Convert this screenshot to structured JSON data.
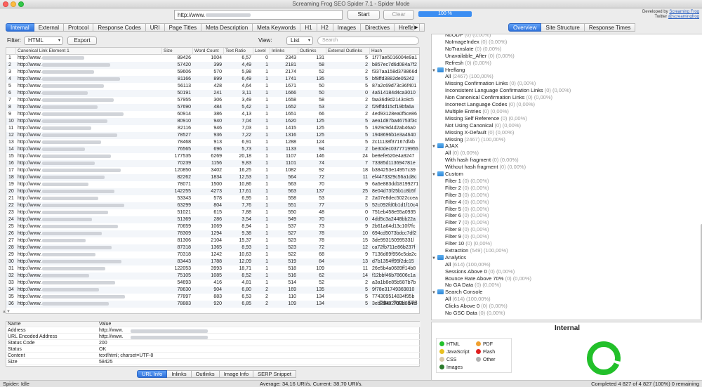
{
  "window": {
    "title": "Screaming Frog SEO Spider 7.1 - Spider Mode"
  },
  "toolbar": {
    "url_value": "http://www.",
    "start_label": "Start",
    "clear_label": "Clear",
    "progress": "100 %",
    "dev_line1": "Developed by",
    "dev_link": "Screaming Frog",
    "dev_line2": "Twitter",
    "dev_twitter": "@screamingfrog"
  },
  "tabs": [
    "Internal",
    "External",
    "Protocol",
    "Response Codes",
    "URI",
    "Page Titles",
    "Meta Description",
    "Meta Keywords",
    "H1",
    "H2",
    "Images",
    "Directives",
    "Hreflang"
  ],
  "filter": {
    "label": "Filter:",
    "value": "HTML",
    "export_label": "Export",
    "view_label": "View:",
    "view_value": "List",
    "search_placeholder": "Search"
  },
  "grid": {
    "columns": [
      "",
      "Canonical Link Element 1",
      "Size",
      "Word Count",
      "Text Ratio",
      "Level",
      "Inlinks",
      "Outlinks",
      "External Outlinks",
      "Hash"
    ],
    "rows": [
      [
        "1",
        "http://www.",
        "89426",
        "1004",
        "6,57",
        "0",
        "2343",
        "131",
        "5",
        "1f77ae5016004e9a1"
      ],
      [
        "2",
        "http://www.",
        "57420",
        "399",
        "4,49",
        "1",
        "2181",
        "58",
        "2",
        "b857ec7d6d084a7f2"
      ],
      [
        "3",
        "http://www.",
        "59606",
        "570",
        "5,98",
        "1",
        "2174",
        "52",
        "2",
        "f337aa158d378866d"
      ],
      [
        "4",
        "http://www.",
        "81166",
        "899",
        "6,49",
        "1",
        "1741",
        "135",
        "5",
        "bf8ffd3882de05242"
      ],
      [
        "5",
        "http://www.",
        "56113",
        "428",
        "4,64",
        "1",
        "1671",
        "50",
        "5",
        "87a2c69d73c36f401"
      ],
      [
        "6",
        "http://www.",
        "50191",
        "241",
        "3,11",
        "1",
        "1666",
        "50",
        "0",
        "4a514184d4ca3010"
      ],
      [
        "7",
        "http://www.",
        "57955",
        "306",
        "3,49",
        "1",
        "1658",
        "58",
        "2",
        "faa36d9d2143c8c5"
      ],
      [
        "8",
        "http://www.",
        "57690",
        "484",
        "5,42",
        "1",
        "1652",
        "53",
        "2",
        "f29ffdd15cf19bfa6a"
      ],
      [
        "9",
        "http://www.",
        "60914",
        "386",
        "4,13",
        "1",
        "1651",
        "66",
        "2",
        "4ed93128ea0f5ce86"
      ],
      [
        "10",
        "http://www.",
        "80910",
        "940",
        "7,04",
        "1",
        "1620",
        "125",
        "5",
        "aea1d87ba46753f3c"
      ],
      [
        "11",
        "http://www.",
        "82116",
        "946",
        "7,03",
        "1",
        "1415",
        "125",
        "5",
        "1929c9d4d2ab46a0"
      ],
      [
        "12",
        "http://www.",
        "78527",
        "936",
        "7,22",
        "1",
        "1316",
        "125",
        "5",
        "1948696b1e3a4640"
      ],
      [
        "13",
        "http://www.",
        "78468",
        "913",
        "6,91",
        "1",
        "1288",
        "124",
        "5",
        "2c11138f37167df4b"
      ],
      [
        "14",
        "http://www.",
        "76565",
        "696",
        "5,73",
        "1",
        "1133",
        "94",
        "2",
        "be30dec0377719955"
      ],
      [
        "15",
        "http://www.",
        "177535",
        "6269",
        "20,18",
        "1",
        "1107",
        "146",
        "24",
        "be8efe620e4a9247"
      ],
      [
        "16",
        "http://www.",
        "70239",
        "1156",
        "9,83",
        "1",
        "1101",
        "74",
        "7",
        "73385d113694781e"
      ],
      [
        "17",
        "http://www.",
        "120850",
        "3402",
        "16,25",
        "1",
        "1082",
        "92",
        "18",
        "b384253e14957c39"
      ],
      [
        "18",
        "http://www.",
        "82262",
        "1834",
        "12,53",
        "1",
        "564",
        "72",
        "11",
        "ef4473329c56a1d8c"
      ],
      [
        "19",
        "http://www.",
        "78071",
        "1500",
        "10,86",
        "1",
        "563",
        "70",
        "9",
        "6a6e883dd18199271"
      ],
      [
        "20",
        "http://www.",
        "142255",
        "4273",
        "17,61",
        "1",
        "563",
        "137",
        "25",
        "8e04d73f25b1c8b5f"
      ],
      [
        "21",
        "http://www.",
        "53343",
        "578",
        "6,95",
        "1",
        "558",
        "53",
        "2",
        "2a07e8dec5022ccea"
      ],
      [
        "22",
        "http://www.",
        "63299",
        "804",
        "7,76",
        "1",
        "551",
        "77",
        "5",
        "52c092fd0b1d1f10c4"
      ],
      [
        "23",
        "http://www.",
        "51021",
        "615",
        "7,88",
        "1",
        "550",
        "48",
        "0",
        "751eb458e55a0935"
      ],
      [
        "24",
        "http://www.",
        "51369",
        "286",
        "3,54",
        "1",
        "549",
        "70",
        "0",
        "4dd5c3a2448bb22a"
      ],
      [
        "25",
        "http://www.",
        "70659",
        "1069",
        "8,94",
        "1",
        "537",
        "73",
        "9",
        "2b61a64d13c10f7fc"
      ],
      [
        "26",
        "http://www.",
        "78309",
        "1294",
        "9,38",
        "1",
        "527",
        "78",
        "10",
        "694cd5073bdcc7df2"
      ],
      [
        "27",
        "http://www.",
        "81306",
        "2104",
        "15,37",
        "1",
        "523",
        "78",
        "15",
        "3de993150995331l"
      ],
      [
        "28",
        "http://www.",
        "87318",
        "1365",
        "8,93",
        "1",
        "523",
        "72",
        "12",
        "ca72fb711e86b237f"
      ],
      [
        "29",
        "http://www.",
        "70318",
        "1242",
        "10,63",
        "1",
        "522",
        "68",
        "9",
        "7136d89f956c5da2c"
      ],
      [
        "30",
        "http://www.",
        "83443",
        "1788",
        "12,09",
        "1",
        "519",
        "84",
        "13",
        "d7b1354ff95f2dc15"
      ],
      [
        "31",
        "http://www.",
        "122053",
        "3993",
        "18,71",
        "1",
        "518",
        "109",
        "11",
        "26e5b4a0689ff14b8"
      ],
      [
        "32",
        "http://www.",
        "75105",
        "1085",
        "8,52",
        "1",
        "516",
        "62",
        "14",
        "f12bbf46b78606c1a"
      ],
      [
        "33",
        "http://www.",
        "54693",
        "416",
        "4,81",
        "1",
        "514",
        "52",
        "2",
        "a3a1b8e85b587b7b"
      ],
      [
        "34",
        "http://www.",
        "78630",
        "904",
        "6,80",
        "2",
        "169",
        "135",
        "5",
        "9f78e31749369810"
      ],
      [
        "35",
        "http://www.",
        "77897",
        "883",
        "6,53",
        "2",
        "110",
        "134",
        "5",
        "774309514834f95b"
      ],
      [
        "36",
        "http://www.",
        "78883",
        "920",
        "6,85",
        "2",
        "109",
        "134",
        "5",
        "3eb29432707b884c"
      ]
    ],
    "filter_total_label": "Filter Total:",
    "filter_total_value": "578"
  },
  "details": {
    "header_name": "Name",
    "header_value": "Value",
    "rows": [
      [
        "Address",
        "http://www."
      ],
      [
        "URL Encoded Address",
        "http://www."
      ],
      [
        "Status Code",
        "200"
      ],
      [
        "Status",
        "OK"
      ],
      [
        "Content",
        "text/html; charset=UTF-8"
      ],
      [
        "Size",
        "58425"
      ]
    ]
  },
  "bottom_tabs": [
    "URL Info",
    "Inlinks",
    "Outlinks",
    "Image Info",
    "SERP Snippet"
  ],
  "right_tabs": [
    "Overview",
    "Site Structure",
    "Response Times"
  ],
  "tree": [
    {
      "indent": 2,
      "label": "NoODP",
      "count": "(0) (0,00%)"
    },
    {
      "indent": 2,
      "label": "NoImageIndex",
      "count": "(0) (0,00%)"
    },
    {
      "indent": 2,
      "label": "NoTranslate",
      "count": "(0) (0,00%)"
    },
    {
      "indent": 2,
      "label": "Unavailable_After",
      "count": "(0) (0,00%)"
    },
    {
      "indent": 2,
      "label": "Refresh",
      "count": "(0) (0,00%)"
    },
    {
      "indent": 0,
      "label": "Hreflang",
      "count": "",
      "folder": true
    },
    {
      "indent": 2,
      "label": "All",
      "count": "(2467) (100,00%)"
    },
    {
      "indent": 2,
      "label": "Missing Confirmation Links",
      "count": "(0) (0,00%)"
    },
    {
      "indent": 2,
      "label": "Inconsistent Language Confirmation Links",
      "count": "(0) (0,00%)"
    },
    {
      "indent": 2,
      "label": "Non Canonical Confirmation Links",
      "count": "(0) (0,00%)"
    },
    {
      "indent": 2,
      "label": "Incorrect Language Codes",
      "count": "(0) (0,00%)"
    },
    {
      "indent": 2,
      "label": "Multiple Entries",
      "count": "(0) (0,00%)"
    },
    {
      "indent": 2,
      "label": "Missing Self Reference",
      "count": "(0) (0,00%)"
    },
    {
      "indent": 2,
      "label": "Not Using Canonical",
      "count": "(0) (0,00%)"
    },
    {
      "indent": 2,
      "label": "Missing X-Default",
      "count": "(0) (0,00%)"
    },
    {
      "indent": 2,
      "label": "Missing",
      "count": "(2467) (100,00%)"
    },
    {
      "indent": 0,
      "label": "AJAX",
      "count": "",
      "folder": true
    },
    {
      "indent": 2,
      "label": "All",
      "count": "(0) (0,00%)"
    },
    {
      "indent": 2,
      "label": "With hash fragment",
      "count": "(0) (0,00%)"
    },
    {
      "indent": 2,
      "label": "Without hash fragment",
      "count": "(0) (0,00%)"
    },
    {
      "indent": 0,
      "label": "Custom",
      "count": "",
      "folder": true
    },
    {
      "indent": 2,
      "label": "Filter 1",
      "count": "(0) (0,00%)"
    },
    {
      "indent": 2,
      "label": "Filter 2",
      "count": "(0) (0,00%)"
    },
    {
      "indent": 2,
      "label": "Filter 3",
      "count": "(0) (0,00%)"
    },
    {
      "indent": 2,
      "label": "Filter 4",
      "count": "(0) (0,00%)"
    },
    {
      "indent": 2,
      "label": "Filter 5",
      "count": "(0) (0,00%)"
    },
    {
      "indent": 2,
      "label": "Filter 6",
      "count": "(0) (0,00%)"
    },
    {
      "indent": 2,
      "label": "Filter 7",
      "count": "(0) (0,00%)"
    },
    {
      "indent": 2,
      "label": "Filter 8",
      "count": "(0) (0,00%)"
    },
    {
      "indent": 2,
      "label": "Filter 9",
      "count": "(0) (0,00%)"
    },
    {
      "indent": 2,
      "label": "Filter 10",
      "count": "(0) (0,00%)"
    },
    {
      "indent": 2,
      "label": "Extraction",
      "count": "(549) (100,00%)"
    },
    {
      "indent": 0,
      "label": "Analytics",
      "count": "",
      "folder": true
    },
    {
      "indent": 2,
      "label": "All",
      "count": "(614) (100,00%)"
    },
    {
      "indent": 2,
      "label": "Sessions Above 0",
      "count": "(0) (0,00%)"
    },
    {
      "indent": 2,
      "label": "Bounce Rate Above 70%",
      "count": "(0) (0,00%)"
    },
    {
      "indent": 2,
      "label": "No GA Data",
      "count": "(0) (0,00%)"
    },
    {
      "indent": 0,
      "label": "Search Console",
      "count": "",
      "folder": true
    },
    {
      "indent": 2,
      "label": "All",
      "count": "(614) (100,00%)"
    },
    {
      "indent": 2,
      "label": "Clicks Above 0",
      "count": "(0) (0,00%)"
    },
    {
      "indent": 2,
      "label": "No GSC Data",
      "count": "(0) (0,00%)"
    }
  ],
  "chart": {
    "title": "Internal",
    "legend": [
      {
        "label": "HTML",
        "color": "#22c02a"
      },
      {
        "label": "PDF",
        "color": "#f0a030"
      },
      {
        "label": "JavaScript",
        "color": "#e8c020"
      },
      {
        "label": "Flash",
        "color": "#e02020"
      },
      {
        "label": "CSS",
        "color": "#d8c8a8"
      },
      {
        "label": "Other",
        "color": "#b0b0b0"
      },
      {
        "label": "Images",
        "color": "#2a7a2a"
      }
    ]
  },
  "status": {
    "left": "Spider: Idle",
    "center": "Average: 34,16 URI/s. Current: 38,70 URI/s.",
    "right": "Completed 4 827 of 4 827 (100%) 0 remaining"
  }
}
